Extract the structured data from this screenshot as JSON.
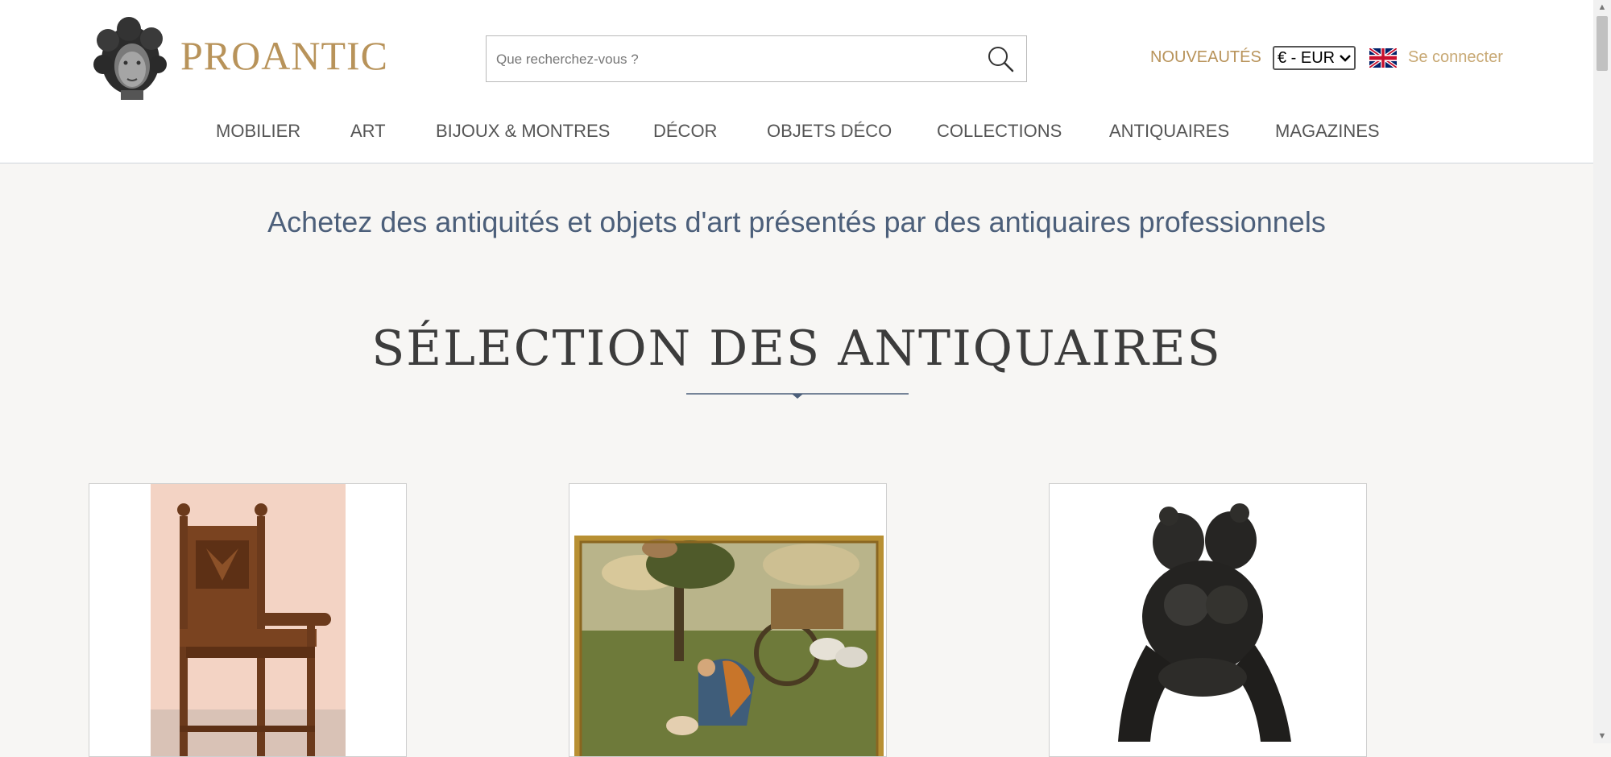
{
  "brand": {
    "name": "PROANTIC"
  },
  "search": {
    "placeholder": "Que recherchez-vous ?"
  },
  "header": {
    "nouveautes": "NOUVEAUTÉS",
    "currency": "€ - EUR",
    "login": "Se connecter",
    "flag_icon": "uk-flag-icon"
  },
  "nav": {
    "items": [
      {
        "label": "MOBILIER"
      },
      {
        "label": "ART"
      },
      {
        "label": "BIJOUX & MONTRES"
      },
      {
        "label": "DÉCOR"
      },
      {
        "label": "OBJETS DÉCO"
      },
      {
        "label": "COLLECTIONS"
      },
      {
        "label": "ANTIQUAIRES"
      },
      {
        "label": "MAGAZINES"
      }
    ]
  },
  "main": {
    "tagline": "Achetez des antiquités et objets d'art présentés par des antiquaires professionnels",
    "section_title": "SÉLECTION DES ANTIQUAIRES"
  },
  "colors": {
    "accent": "#b8935a",
    "tagline": "#4c5f7a"
  }
}
